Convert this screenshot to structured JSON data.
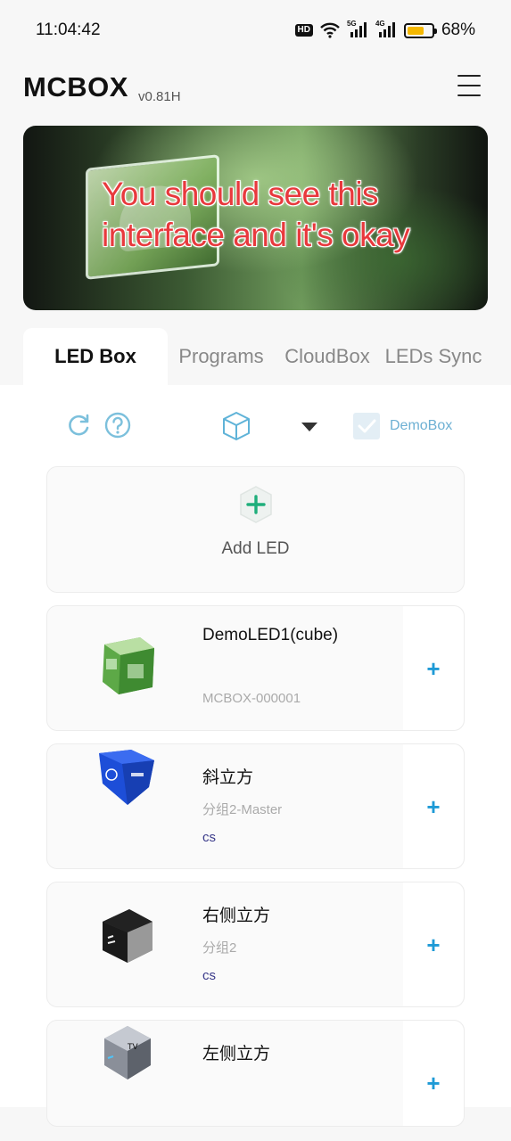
{
  "status_bar": {
    "time": "11:04:42",
    "hd_badge": "HD",
    "network_5g": "5G",
    "network_4g": "4G",
    "battery_percent": "68%",
    "battery_level": 0.68,
    "battery_color": "#f5b800",
    "icons": [
      "wifi-icon",
      "signal-5g-icon",
      "signal-4g-icon",
      "battery-icon"
    ]
  },
  "header": {
    "title": "MCBOX",
    "version": "v0.81H",
    "menu_icon": "hamburger-menu-icon"
  },
  "banner": {
    "overlay_text": "You should see this interface and it's okay",
    "overlay_color": "#e8393d"
  },
  "tabs": [
    {
      "label": "LED Box",
      "active": true
    },
    {
      "label": "Programs",
      "active": false
    },
    {
      "label": "CloudBox",
      "active": false
    },
    {
      "label": "LEDs Sync",
      "active": false
    }
  ],
  "toolbar": {
    "refresh_icon": "refresh-icon",
    "help_icon": "help-icon",
    "box_icon": "cube-icon",
    "dropdown_icon": "dropdown-arrow-icon",
    "demobox_checked": true,
    "demobox_label": "DemoBox",
    "accent_color": "#6db0d3"
  },
  "add_led": {
    "label": "Add LED",
    "icon": "add-hexagon-icon"
  },
  "led_list": [
    {
      "name": "DemoLED1(cube)",
      "subtitle": "",
      "serial": "MCBOX-000001",
      "extra": "",
      "thumb": "green-cube-thumbnail"
    },
    {
      "name": "斜立方",
      "subtitle": "分组2-Master",
      "serial": "",
      "extra": "cs",
      "thumb": "blue-cube-thumbnail"
    },
    {
      "name": "右侧立方",
      "subtitle": "分组2",
      "serial": "",
      "extra": "cs",
      "thumb": "gray-cube-thumbnail"
    },
    {
      "name": "左侧立方",
      "subtitle": "",
      "serial": "",
      "extra": "",
      "thumb": "tv-cube-thumbnail"
    }
  ],
  "plus_label": "+",
  "plus_color": "#1e9ad6"
}
